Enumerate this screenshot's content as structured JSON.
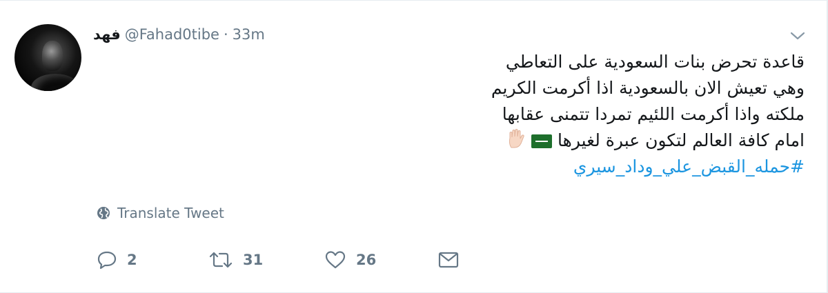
{
  "tweet": {
    "author": {
      "display_name": "فهد",
      "handle": "@Fahad0tibe",
      "separator": "·",
      "time": "33m"
    },
    "text_lines": [
      "قاعدة تحرض بنات السعودية على التعاطي",
      "وهي تعيش الان بالسعودية اذا أكرمت الكريم",
      "ملكته واذا أكرمت اللئيم تمردا تتمنى عقابها",
      "امام كافة العالم لتكون عبرة لغيرها"
    ],
    "emoji": [
      "saudi-flag",
      "raised-hand"
    ],
    "hashtag": "#حمله_القبض_علي_وداد_سيري",
    "translate_label": "Translate Tweet",
    "actions": {
      "replies": "2",
      "retweets": "31",
      "likes": "26"
    }
  },
  "colors": {
    "link": "#1b95e0",
    "muted": "#657786",
    "text": "#14171a",
    "border": "#e6ecf0"
  }
}
